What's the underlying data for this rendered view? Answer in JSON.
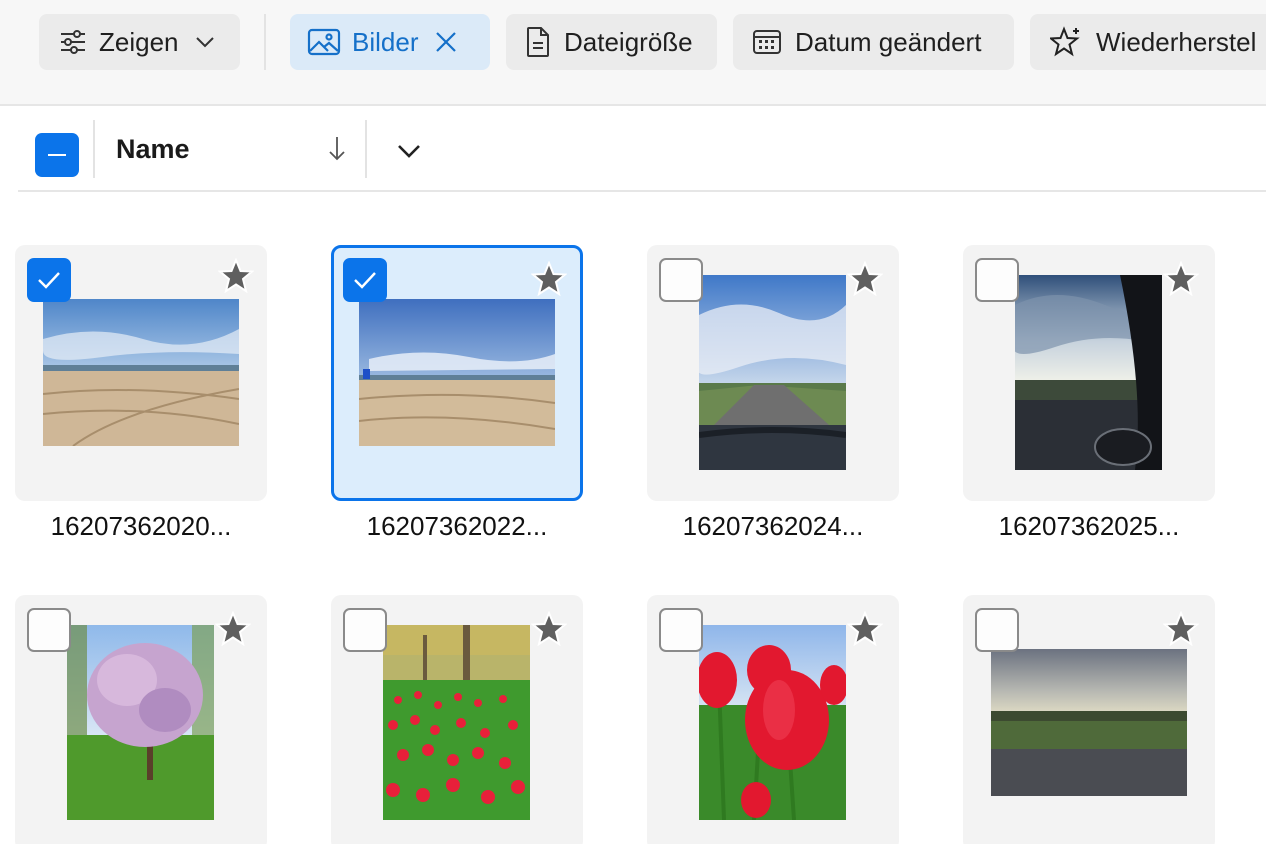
{
  "toolbar": {
    "filters": [
      {
        "label": "Zeigen",
        "icon": "sliders-icon"
      },
      {
        "label": "Bilder",
        "icon": "image-icon",
        "active": true
      },
      {
        "label": "Dateigröße",
        "icon": "document-icon"
      },
      {
        "label": "Datum geändert",
        "icon": "calendar-icon"
      },
      {
        "label": "Wiederherstel",
        "icon": "star-sparkle-icon"
      }
    ],
    "accent_color": "#0b74ea"
  },
  "header": {
    "sort_column": "Name",
    "sort_direction": "descending"
  },
  "files": [
    {
      "name": "16207362020...",
      "selected": true,
      "favorite": false,
      "thumb": "beach"
    },
    {
      "name": "16207362022...",
      "selected": true,
      "favorite": false,
      "thumb": "beach-blue"
    },
    {
      "name": "16207362024...",
      "selected": false,
      "favorite": false,
      "thumb": "road-clouds"
    },
    {
      "name": "16207362025...",
      "selected": false,
      "favorite": false,
      "thumb": "car-window-sky"
    },
    {
      "name": "",
      "selected": false,
      "favorite": false,
      "thumb": "blossom-tree"
    },
    {
      "name": "",
      "selected": false,
      "favorite": false,
      "thumb": "tulip-field"
    },
    {
      "name": "",
      "selected": false,
      "favorite": false,
      "thumb": "red-tulips"
    },
    {
      "name": "",
      "selected": false,
      "favorite": false,
      "thumb": "overcast-field"
    }
  ]
}
